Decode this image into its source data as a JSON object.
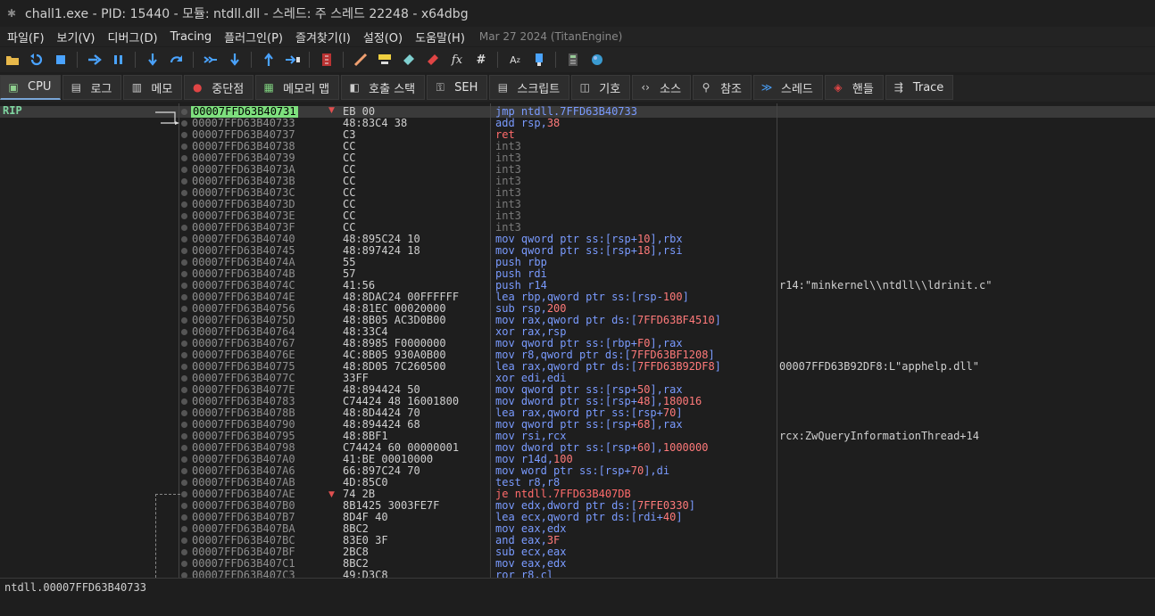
{
  "window": {
    "title": "chall1.exe - PID: 15440 - 모듈: ntdll.dll - 스레드: 주 스레드 22248 - x64dbg"
  },
  "menu": {
    "items": [
      "파일(F)",
      "보기(V)",
      "디버그(D)",
      "Tracing",
      "플러그인(P)",
      "즐겨찾기(I)",
      "설정(O)",
      "도움말(H)"
    ],
    "date": "Mar 27 2024 (TitanEngine)"
  },
  "toolbar": {
    "buttons": [
      "open-icon",
      "restart-icon",
      "stop-icon",
      "run-icon",
      "pause-icon",
      "step-into-icon",
      "step-over-icon",
      "trace-into-icon",
      "trace-over-icon",
      "execute-till-return-icon",
      "run-to-user-code-icon",
      "scylla-icon",
      "patch-icon",
      "comment-icon",
      "label-icon",
      "bookmark-icon",
      "function-icon",
      "hash-icon",
      "font-icon",
      "tool-icon",
      "calculator-icon",
      "globe-icon"
    ],
    "labels": {
      "function": "fx",
      "hash": "#",
      "font": "A",
      "font_sub": "z"
    }
  },
  "tabs": [
    {
      "label": "CPU",
      "icon": "cpu-icon"
    },
    {
      "label": "로그",
      "icon": "log-icon"
    },
    {
      "label": "메모",
      "icon": "notes-icon"
    },
    {
      "label": "중단점",
      "icon": "breakpoint-icon"
    },
    {
      "label": "메모리 맵",
      "icon": "memory-map-icon"
    },
    {
      "label": "호출 스택",
      "icon": "call-stack-icon"
    },
    {
      "label": "SEH",
      "icon": "seh-icon"
    },
    {
      "label": "스크립트",
      "icon": "script-icon"
    },
    {
      "label": "기호",
      "icon": "symbols-icon"
    },
    {
      "label": "소스",
      "icon": "source-icon"
    },
    {
      "label": "참조",
      "icon": "references-icon"
    },
    {
      "label": "스레드",
      "icon": "threads-icon"
    },
    {
      "label": "핸들",
      "icon": "handles-icon"
    },
    {
      "label": "Trace",
      "icon": "trace-icon"
    }
  ],
  "cpu": {
    "rip_label": "RIP",
    "rows": [
      {
        "addr": "00007FFD63B40731",
        "bytes": "EB 00",
        "mn": "jmp",
        "ops": "ntdll.7FFD63B40733",
        "cmt": "",
        "cur": true
      },
      {
        "addr": "00007FFD63B40733",
        "bytes": "48:83C4 38",
        "mn": "add",
        "ops": "rsp,38",
        "cmt": ""
      },
      {
        "addr": "00007FFD63B40737",
        "bytes": "C3",
        "mn": "ret",
        "ops": "",
        "cmt": ""
      },
      {
        "addr": "00007FFD63B40738",
        "bytes": "CC",
        "mn": "int3",
        "ops": "",
        "cmt": ""
      },
      {
        "addr": "00007FFD63B40739",
        "bytes": "CC",
        "mn": "int3",
        "ops": "",
        "cmt": ""
      },
      {
        "addr": "00007FFD63B4073A",
        "bytes": "CC",
        "mn": "int3",
        "ops": "",
        "cmt": ""
      },
      {
        "addr": "00007FFD63B4073B",
        "bytes": "CC",
        "mn": "int3",
        "ops": "",
        "cmt": ""
      },
      {
        "addr": "00007FFD63B4073C",
        "bytes": "CC",
        "mn": "int3",
        "ops": "",
        "cmt": ""
      },
      {
        "addr": "00007FFD63B4073D",
        "bytes": "CC",
        "mn": "int3",
        "ops": "",
        "cmt": ""
      },
      {
        "addr": "00007FFD63B4073E",
        "bytes": "CC",
        "mn": "int3",
        "ops": "",
        "cmt": ""
      },
      {
        "addr": "00007FFD63B4073F",
        "bytes": "CC",
        "mn": "int3",
        "ops": "",
        "cmt": ""
      },
      {
        "addr": "00007FFD63B40740",
        "bytes": "48:895C24 10",
        "mn": "mov",
        "ops": "qword ptr ss:[rsp+10],rbx",
        "cmt": ""
      },
      {
        "addr": "00007FFD63B40745",
        "bytes": "48:897424 18",
        "mn": "mov",
        "ops": "qword ptr ss:[rsp+18],rsi",
        "cmt": ""
      },
      {
        "addr": "00007FFD63B4074A",
        "bytes": "55",
        "mn": "push",
        "ops": "rbp",
        "cmt": ""
      },
      {
        "addr": "00007FFD63B4074B",
        "bytes": "57",
        "mn": "push",
        "ops": "rdi",
        "cmt": ""
      },
      {
        "addr": "00007FFD63B4074C",
        "bytes": "41:56",
        "mn": "push",
        "ops": "r14",
        "cmt": "r14:\"minkernel\\\\ntdll\\\\ldrinit.c\""
      },
      {
        "addr": "00007FFD63B4074E",
        "bytes": "48:8DAC24 00FFFFFF",
        "mn": "lea",
        "ops": "rbp,qword ptr ss:[rsp-100]",
        "cmt": ""
      },
      {
        "addr": "00007FFD63B40756",
        "bytes": "48:81EC 00020000",
        "mn": "sub",
        "ops": "rsp,200",
        "cmt": ""
      },
      {
        "addr": "00007FFD63B4075D",
        "bytes": "48:8B05 AC3D0B00",
        "mn": "mov",
        "ops": "rax,qword ptr ds:[7FFD63BF4510]",
        "cmt": ""
      },
      {
        "addr": "00007FFD63B40764",
        "bytes": "48:33C4",
        "mn": "xor",
        "ops": "rax,rsp",
        "cmt": ""
      },
      {
        "addr": "00007FFD63B40767",
        "bytes": "48:8985 F0000000",
        "mn": "mov",
        "ops": "qword ptr ss:[rbp+F0],rax",
        "cmt": ""
      },
      {
        "addr": "00007FFD63B4076E",
        "bytes": "4C:8B05 930A0B00",
        "mn": "mov",
        "ops": "r8,qword ptr ds:[7FFD63BF1208]",
        "cmt": ""
      },
      {
        "addr": "00007FFD63B40775",
        "bytes": "48:8D05 7C260500",
        "mn": "lea",
        "ops": "rax,qword ptr ds:[7FFD63B92DF8]",
        "cmt": "00007FFD63B92DF8:L\"apphelp.dll\""
      },
      {
        "addr": "00007FFD63B4077C",
        "bytes": "33FF",
        "mn": "xor",
        "ops": "edi,edi",
        "cmt": ""
      },
      {
        "addr": "00007FFD63B4077E",
        "bytes": "48:894424 50",
        "mn": "mov",
        "ops": "qword ptr ss:[rsp+50],rax",
        "cmt": ""
      },
      {
        "addr": "00007FFD63B40783",
        "bytes": "C74424 48 16001800",
        "mn": "mov",
        "ops": "dword ptr ss:[rsp+48],180016",
        "cmt": ""
      },
      {
        "addr": "00007FFD63B4078B",
        "bytes": "48:8D4424 70",
        "mn": "lea",
        "ops": "rax,qword ptr ss:[rsp+70]",
        "cmt": ""
      },
      {
        "addr": "00007FFD63B40790",
        "bytes": "48:894424 68",
        "mn": "mov",
        "ops": "qword ptr ss:[rsp+68],rax",
        "cmt": ""
      },
      {
        "addr": "00007FFD63B40795",
        "bytes": "48:8BF1",
        "mn": "mov",
        "ops": "rsi,rcx",
        "cmt": "rcx:ZwQueryInformationThread+14"
      },
      {
        "addr": "00007FFD63B40798",
        "bytes": "C74424 60 00000001",
        "mn": "mov",
        "ops": "dword ptr ss:[rsp+60],1000000",
        "cmt": ""
      },
      {
        "addr": "00007FFD63B407A0",
        "bytes": "41:BE 00010000",
        "mn": "mov",
        "ops": "r14d,100",
        "cmt": ""
      },
      {
        "addr": "00007FFD63B407A6",
        "bytes": "66:897C24 70",
        "mn": "mov",
        "ops": "word ptr ss:[rsp+70],di",
        "cmt": ""
      },
      {
        "addr": "00007FFD63B407AB",
        "bytes": "4D:85C0",
        "mn": "test",
        "ops": "r8,r8",
        "cmt": ""
      },
      {
        "addr": "00007FFD63B407AE",
        "bytes": "74 2B",
        "mn": "je",
        "ops": "ntdll.7FFD63B407DB",
        "cmt": ""
      },
      {
        "addr": "00007FFD63B407B0",
        "bytes": "8B1425 3003FE7F",
        "mn": "mov",
        "ops": "edx,dword ptr ds:[7FFE0330]",
        "cmt": ""
      },
      {
        "addr": "00007FFD63B407B7",
        "bytes": "8D4F 40",
        "mn": "lea",
        "ops": "ecx,qword ptr ds:[rdi+40]",
        "cmt": ""
      },
      {
        "addr": "00007FFD63B407BA",
        "bytes": "8BC2",
        "mn": "mov",
        "ops": "eax,edx",
        "cmt": ""
      },
      {
        "addr": "00007FFD63B407BC",
        "bytes": "83E0 3F",
        "mn": "and",
        "ops": "eax,3F",
        "cmt": ""
      },
      {
        "addr": "00007FFD63B407BF",
        "bytes": "2BC8",
        "mn": "sub",
        "ops": "ecx,eax",
        "cmt": ""
      },
      {
        "addr": "00007FFD63B407C1",
        "bytes": "8BC2",
        "mn": "mov",
        "ops": "eax,edx",
        "cmt": ""
      },
      {
        "addr": "00007FFD63B407C3",
        "bytes": "49:D3C8",
        "mn": "ror",
        "ops": "r8,cl",
        "cmt": ""
      }
    ]
  },
  "status": {
    "text": "ntdll.00007FFD63B40733"
  }
}
